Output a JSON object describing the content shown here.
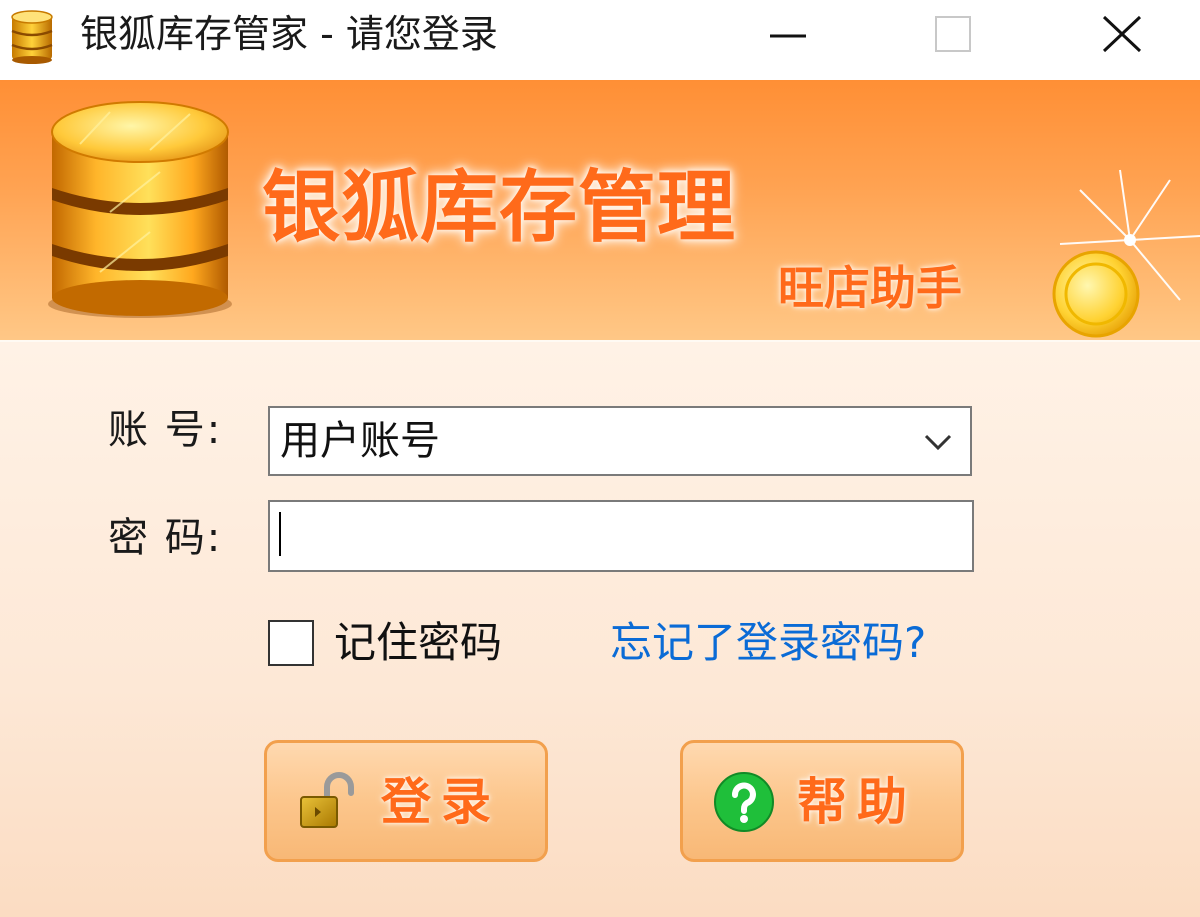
{
  "window": {
    "title": "银狐库存管家 - 请您登录",
    "controls": {
      "minimize_icon": "minimize-icon",
      "maximize_icon": "maximize-icon",
      "close_icon": "close-icon"
    }
  },
  "banner": {
    "brand_title": "银狐库存管理",
    "brand_subtitle": "旺店助手",
    "logo_icon": "database-icon",
    "decoration_icon": "gold-coin-sparkle-icon",
    "colors": {
      "top": "#ff8f35",
      "bottom": "#ffc887",
      "brand_text": "#ff6a1a"
    }
  },
  "form": {
    "account_label": "账  号:",
    "account_value": "用户账号",
    "password_label": "密  码:",
    "password_value": "",
    "remember_label": "记住密码",
    "remember_checked": false,
    "forgot_link": "忘记了登录密码?",
    "link_color": "#0a6bd6"
  },
  "actions": {
    "login_label": "登录",
    "login_icon": "unlocked-padlock-icon",
    "help_label": "帮助",
    "help_icon": "question-circle-icon"
  }
}
